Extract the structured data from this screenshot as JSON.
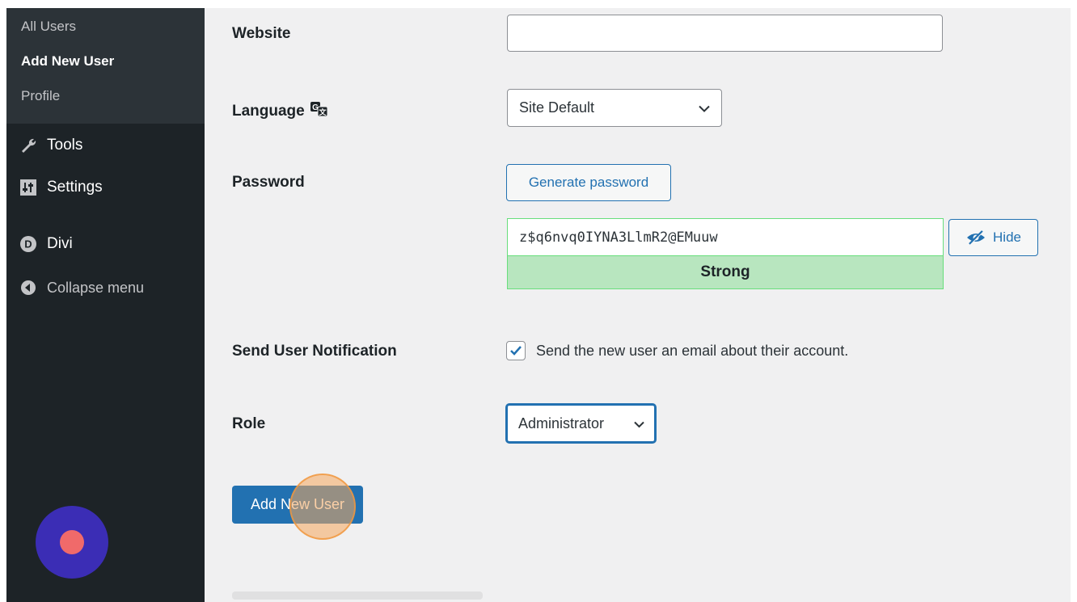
{
  "sidebar": {
    "submenu": [
      {
        "label": "All Users",
        "current": false
      },
      {
        "label": "Add New User",
        "current": true
      },
      {
        "label": "Profile",
        "current": false
      }
    ],
    "tools_label": "Tools",
    "settings_label": "Settings",
    "divi_label": "Divi",
    "collapse_label": "Collapse menu"
  },
  "form": {
    "website_label": "Website",
    "website_value": "",
    "language_label": "Language",
    "language_value": "Site Default",
    "password_label": "Password",
    "generate_password_label": "Generate password",
    "password_value": "z$q6nvq0IYNA3LlmR2@EMuuw",
    "hide_label": "Hide",
    "strength_label": "Strong",
    "notification_label": "Send User Notification",
    "notification_checked": true,
    "notification_text": "Send the new user an email about their account.",
    "role_label": "Role",
    "role_value": "Administrator",
    "submit_label": "Add New User"
  },
  "colors": {
    "accent": "#2271b1",
    "sidebar_bg": "#1d2327",
    "strength_bg": "#b8e6bf",
    "recorder": "#3b2db5"
  }
}
